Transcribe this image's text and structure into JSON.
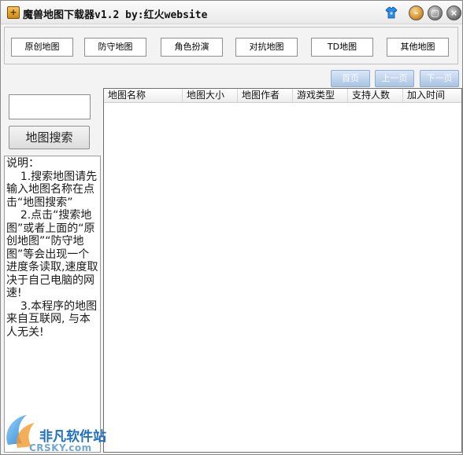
{
  "window": {
    "title": "魔兽地图下载器v1.2  by:红火website"
  },
  "categories": [
    {
      "label": "原创地图"
    },
    {
      "label": "防守地图"
    },
    {
      "label": "角色扮演"
    },
    {
      "label": "对抗地图"
    },
    {
      "label": "TD地图"
    },
    {
      "label": "其他地图"
    }
  ],
  "pager": {
    "first": "首页",
    "prev": "上一页",
    "next": "下一页"
  },
  "search": {
    "input_value": "",
    "button_label": "地图搜索"
  },
  "notes": {
    "text": "说明：\n    1.搜索地图请先输入地图名称在点击“地图搜索”\n    2.点击“搜索地图”或者上面的“原创地图”“防守地图”等会出现一个进度条读取,速度取决于自己电脑的网速!\n    3.本程序的地图来自互联网, 与本人无关!"
  },
  "list": {
    "columns": [
      "地图名称",
      "地图大小",
      "地图作者",
      "游戏类型",
      "支持人数",
      "加入时间"
    ],
    "rows": []
  },
  "watermark": {
    "brand": "非凡软件站",
    "sub": "CRSKY.com"
  },
  "colors": {
    "pager_button": "#a9c3e3",
    "watermark_blue": "#1f6fc2"
  }
}
